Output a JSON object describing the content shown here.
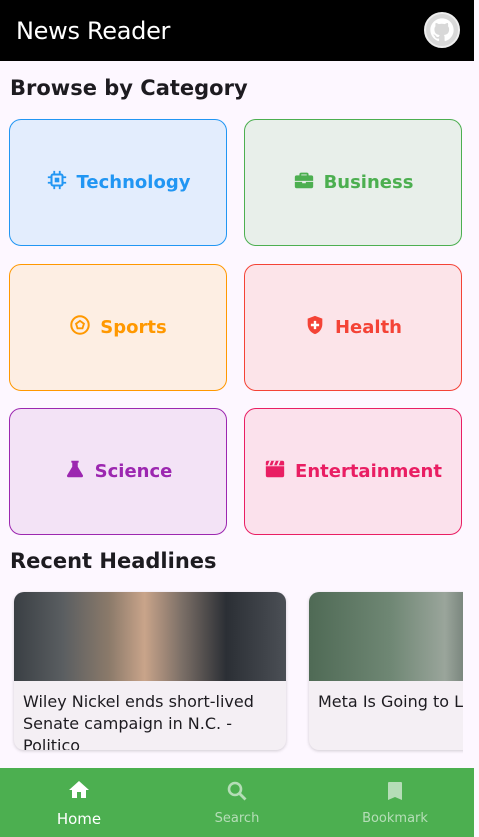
{
  "appbar": {
    "title": "News Reader"
  },
  "categories_section": {
    "title": "Browse by Category"
  },
  "categories": [
    {
      "label": "Technology",
      "icon": "chip-icon",
      "color": "#2196f3",
      "bg": "#e3edfd"
    },
    {
      "label": "Business",
      "icon": "briefcase-icon",
      "color": "#4caf50",
      "bg": "#e8efea"
    },
    {
      "label": "Sports",
      "icon": "soccer-ball-icon",
      "color": "#ff9800",
      "bg": "#fdeee3"
    },
    {
      "label": "Health",
      "icon": "medical-shield-icon",
      "color": "#f44336",
      "bg": "#fce4e9"
    },
    {
      "label": "Science",
      "icon": "flask-icon",
      "color": "#9c27b0",
      "bg": "#f3e3f6"
    },
    {
      "label": "Entertainment",
      "icon": "movie-clapper-icon",
      "color": "#e91e63",
      "bg": "#fbe1ec"
    }
  ],
  "headlines_section": {
    "title": "Recent Headlines"
  },
  "headlines": [
    {
      "title": "Wiley Nickel ends short-lived Senate campaign in N.C. - Politico"
    },
    {
      "title": "Meta Is Going to Let Candidates Use AI D"
    }
  ],
  "bottom_nav": [
    {
      "label": "Home",
      "icon": "home-icon",
      "active": true
    },
    {
      "label": "Search",
      "icon": "search-icon",
      "active": false
    },
    {
      "label": "Bookmark",
      "icon": "bookmark-icon",
      "active": false
    }
  ]
}
